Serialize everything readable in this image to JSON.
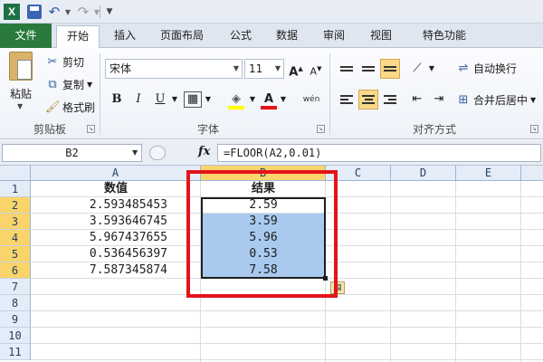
{
  "quick_access": {
    "app_letter": "X"
  },
  "tabs": [
    {
      "label": "文件"
    },
    {
      "label": "开始"
    },
    {
      "label": "插入"
    },
    {
      "label": "页面布局"
    },
    {
      "label": "公式"
    },
    {
      "label": "数据"
    },
    {
      "label": "审阅"
    },
    {
      "label": "视图"
    },
    {
      "label": "特色功能"
    }
  ],
  "ribbon": {
    "clipboard": {
      "paste": "粘贴",
      "cut": "剪切",
      "copy": "复制",
      "format_painter": "格式刷",
      "group_label": "剪贴板"
    },
    "font": {
      "font_name": "宋体",
      "font_size": "11",
      "bold": "B",
      "italic": "I",
      "underline": "U",
      "group_label": "字体"
    },
    "alignment": {
      "wrap_text": "自动换行",
      "merge_center": "合并后居中",
      "group_label": "对齐方式"
    }
  },
  "formula_bar": {
    "name_box": "B2",
    "fx": "fx",
    "formula": "=FLOOR(A2,0.01)"
  },
  "sheet": {
    "columns": [
      "A",
      "B",
      "C",
      "D",
      "E"
    ],
    "rows": [
      "1",
      "2",
      "3",
      "4",
      "5",
      "6",
      "7",
      "8",
      "9",
      "10",
      "11"
    ],
    "header_a": "数值",
    "header_b": "结果",
    "values": [
      "2.593485453",
      "3.593646745",
      "5.967437655",
      "0.536456397",
      "7.587345874"
    ],
    "results": [
      "2.59",
      "3.59",
      "5.96",
      "0.53",
      "7.58"
    ],
    "selection_color": "#a9c9ee",
    "annotation_color": "#e3141a"
  }
}
